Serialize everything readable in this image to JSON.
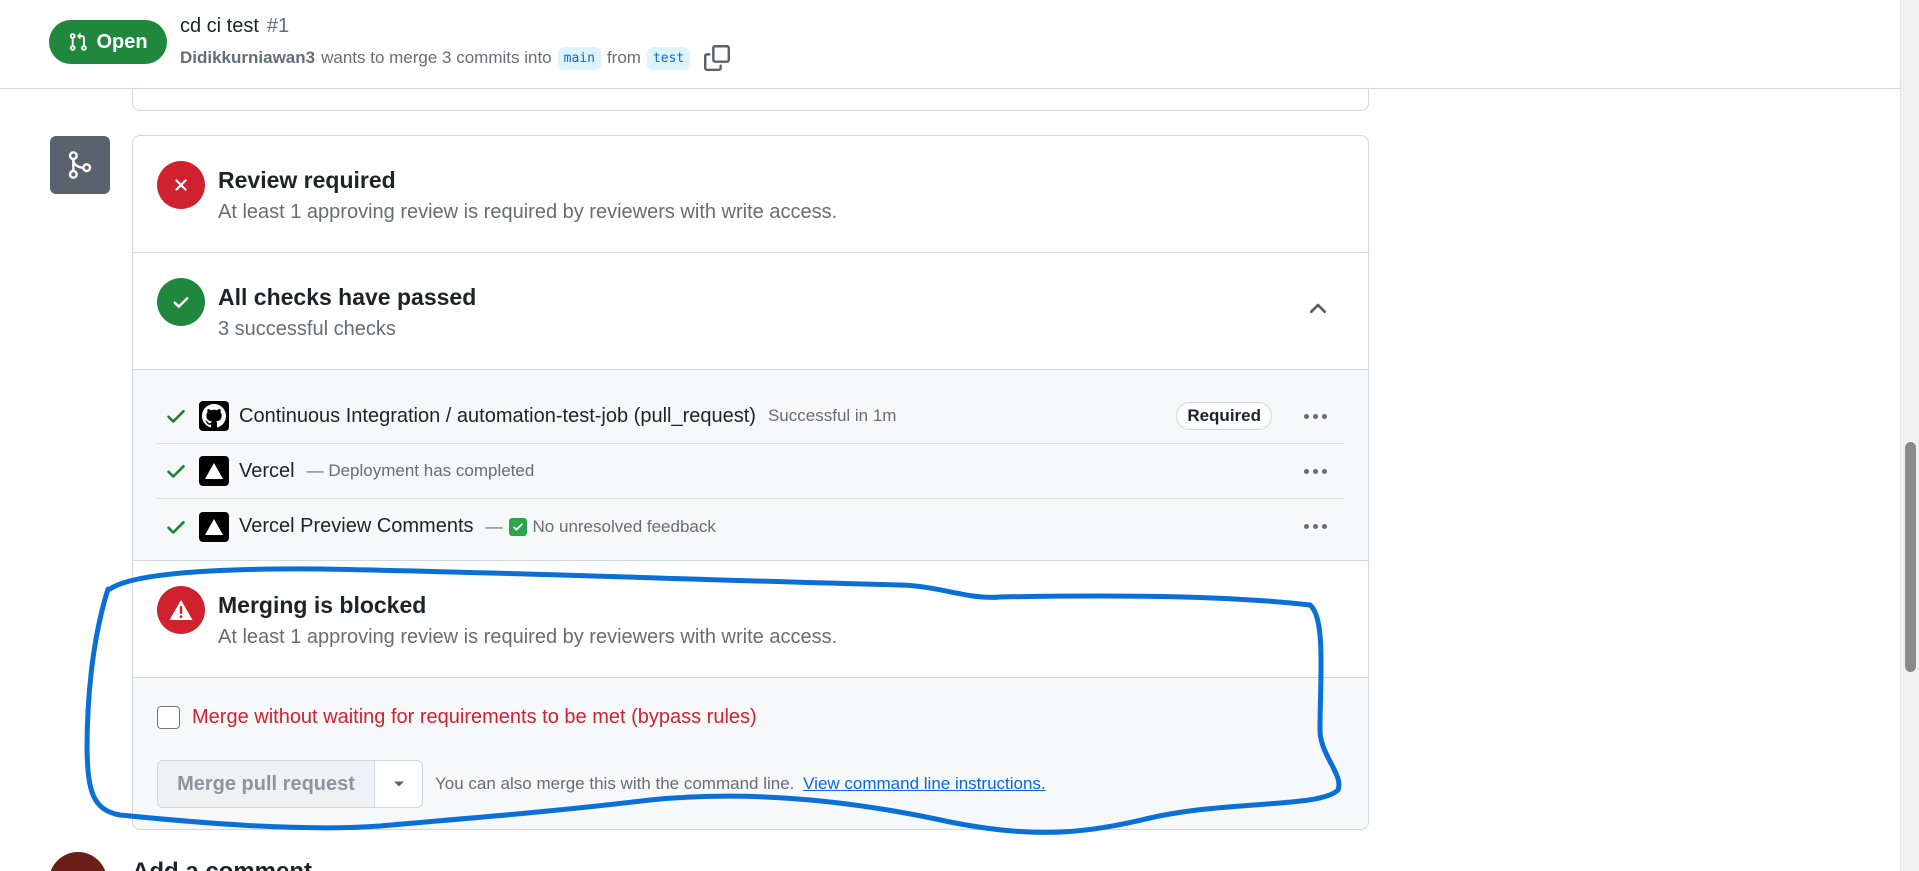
{
  "header": {
    "state_label": "Open",
    "title": "cd ci test",
    "number": "#1",
    "author": "Didikkurniawan3",
    "meta_text": "wants to merge 3 commits into",
    "base_branch": "main",
    "from_text": "from",
    "head_branch": "test"
  },
  "review": {
    "title": "Review required",
    "description": "At least 1 approving review is required by reviewers with write access."
  },
  "checks": {
    "title": "All checks have passed",
    "description": "3 successful checks",
    "items": [
      {
        "name": "Continuous Integration / automation-test-job (pull_request)",
        "detail": "Successful in 1m",
        "badge": "Required",
        "icon": "github-icon"
      },
      {
        "name": "Vercel",
        "detail": "— Deployment has completed",
        "icon": "vercel-icon"
      },
      {
        "name": "Vercel Preview Comments",
        "detail_prefix": "—",
        "detail": "No unresolved feedback",
        "icon": "vercel-icon"
      }
    ]
  },
  "blocked": {
    "title": "Merging is blocked",
    "description": "At least 1 approving review is required by reviewers with write access."
  },
  "merge": {
    "bypass_label": "Merge without waiting for requirements to be met (bypass rules)",
    "button_label": "Merge pull request",
    "help_text": "You can also merge this with the command line.",
    "help_link": "View command line instructions."
  },
  "comment": {
    "title": "Add a comment"
  },
  "colors": {
    "open_green": "#1f883d",
    "danger_red": "#cf222e",
    "link_blue": "#0969da",
    "annotation_blue": "#0a6fd6"
  }
}
